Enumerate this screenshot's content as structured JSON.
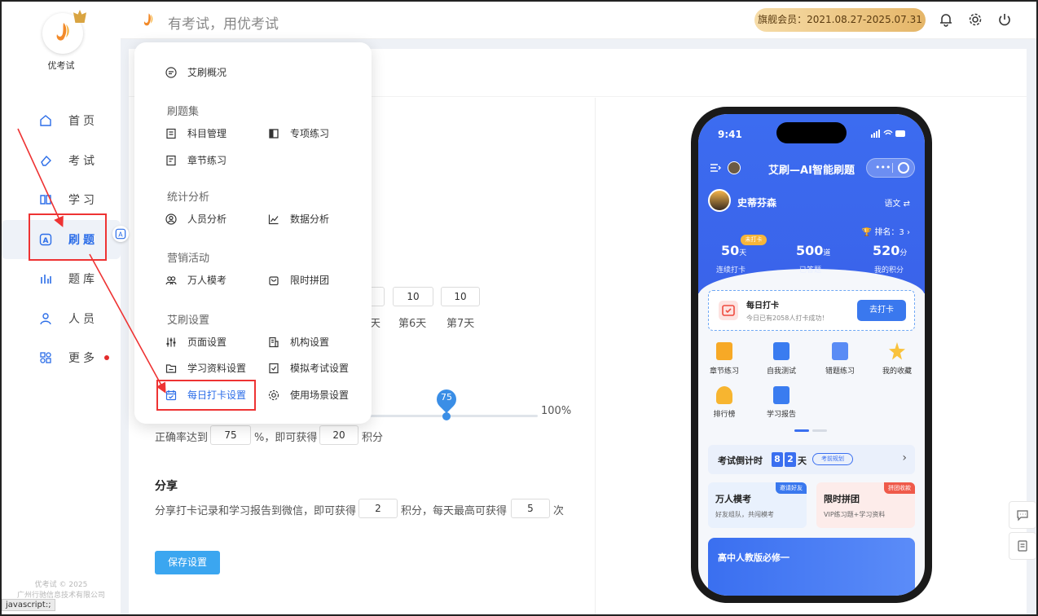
{
  "sidebar": {
    "brand": "优考试",
    "items": [
      {
        "label": "首页",
        "icon": "home-icon"
      },
      {
        "label": "考试",
        "icon": "eraser-icon"
      },
      {
        "label": "学习",
        "icon": "book-icon"
      },
      {
        "label": "刷题",
        "icon": "letter-a-icon"
      },
      {
        "label": "题库",
        "icon": "bars-icon"
      },
      {
        "label": "人员",
        "icon": "person-icon"
      },
      {
        "label": "更多",
        "icon": "apps-icon"
      }
    ],
    "active_item": "刷题",
    "footer_line1": "优考试 © 2025",
    "footer_line2": "广州行驰信息技术有限公司"
  },
  "status_bar": "javascript:;",
  "header": {
    "slogan": "有考试，用优考试",
    "vip_label": "旗舰会员：2021.08.27-2025.07.31"
  },
  "menu": {
    "overview": "艾刷概况",
    "groups": [
      {
        "title": "刷题集",
        "items": [
          "科目管理",
          "专项练习",
          "章节练习"
        ]
      },
      {
        "title": "统计分析",
        "items": [
          "人员分析",
          "数据分析"
        ]
      },
      {
        "title": "营销活动",
        "items": [
          "万人模考",
          "限时拼团"
        ]
      },
      {
        "title": "艾刷设置",
        "items": [
          "页面设置",
          "机构设置",
          "学习资料设置",
          "模拟考试设置",
          "每日打卡设置",
          "使用场景设置"
        ]
      }
    ],
    "active": "每日打卡设置"
  },
  "form": {
    "day_values": [
      "10",
      "10"
    ],
    "day_partial": "天",
    "day6_label": "第6天",
    "day7_label": "第7天",
    "slider_value": 75,
    "slider_max_label": "100%",
    "accuracy_prefix": "正确率达到",
    "accuracy_value": "75",
    "accuracy_mid": "%，即可获得",
    "accuracy_points": "20",
    "accuracy_suffix": "积分",
    "share_title": "分享",
    "share_prefix": "分享打卡记录和学习报告到微信，即可获得",
    "share_points": "2",
    "share_mid": "积分，每天最高可获得",
    "share_max": "5",
    "share_suffix": "次",
    "save_label": "保存设置"
  },
  "phone": {
    "time": "9:41",
    "title": "艾刷—AI智能刷题",
    "user": "史蒂芬森",
    "lang": "语文 ⇄",
    "rank": "排名：3",
    "badge": "未打卡",
    "stats": [
      {
        "num": "50",
        "unit": "天",
        "label": "连续打卡"
      },
      {
        "num": "500",
        "unit": "道",
        "label": "已答题"
      },
      {
        "num": "520",
        "unit": "分",
        "label": "我的积分"
      }
    ],
    "checkin_title": "每日打卡",
    "checkin_sub": "今日已有2058人打卡成功！",
    "checkin_btn": "去打卡",
    "grid": [
      "章节练习",
      "自我测试",
      "错题练习",
      "我的收藏",
      "排行榜",
      "学习报告"
    ],
    "countdown_label": "考试倒计时",
    "countdown_digits": [
      "8",
      "2"
    ],
    "countdown_unit": "天",
    "countdown_tag": "考前规划",
    "card1_title": "万人模考",
    "card1_sub": "好友组队，共闯模考",
    "card1_tag": "邀请好友",
    "card2_title": "限时拼团",
    "card2_sub": "VIP练习题+学习资料",
    "card2_tag": "拼团收款",
    "banner_title": "高中人教版必修一"
  },
  "colors": {
    "accent": "#2b6de8",
    "vip_gold": "#e5b668",
    "annotation_red": "#ee3333"
  }
}
